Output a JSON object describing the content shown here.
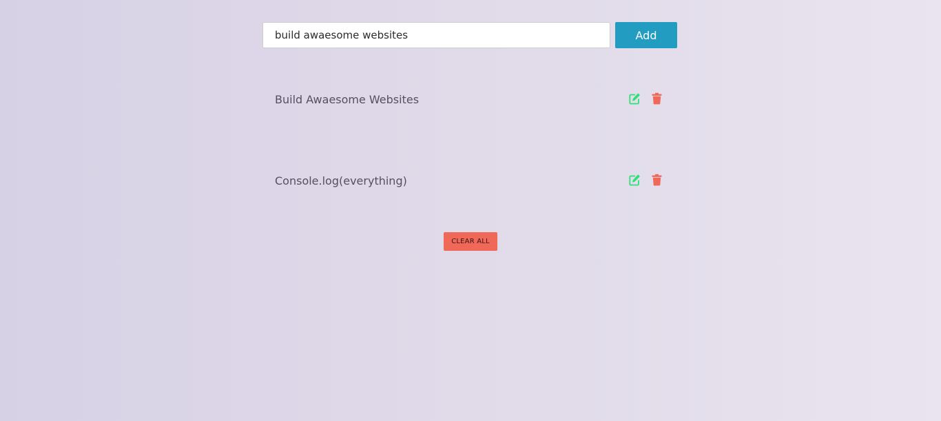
{
  "form": {
    "input_value": "build awaesome websites",
    "add_label": "Add"
  },
  "tasks": [
    {
      "text": "Build Awaesome Websites",
      "edit_icon": "edit-icon",
      "delete_icon": "trash-icon"
    },
    {
      "text": "Console.log(everything)",
      "edit_icon": "edit-icon",
      "delete_icon": "trash-icon"
    }
  ],
  "clear_all_label": "CLEAR ALL",
  "colors": {
    "accent": "#229cc0",
    "edit": "#2ee078",
    "delete": "#f06858",
    "text": "#545061"
  }
}
